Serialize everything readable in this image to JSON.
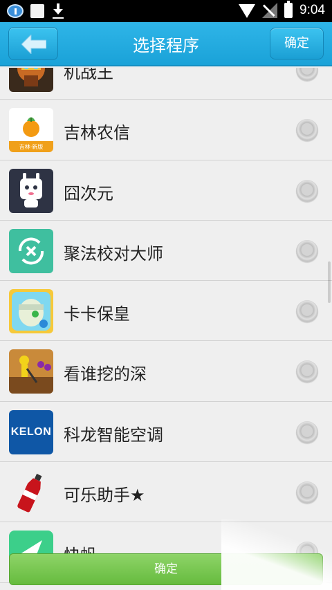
{
  "status_bar": {
    "time": "9:04",
    "icons": [
      "message-icon",
      "square-icon",
      "download-icon",
      "wifi-icon",
      "signal-icon",
      "battery-icon"
    ]
  },
  "header": {
    "title": "选择程序",
    "confirm_label": "确定",
    "back_icon": "back-arrow-icon",
    "color": "#1fa8dd"
  },
  "apps": [
    {
      "name": "机战王",
      "icon": "robot-app-icon"
    },
    {
      "name": "吉林农信",
      "icon": "jilin-nongxin-icon",
      "icon_label": "吉林·新版"
    },
    {
      "name": "囧次元",
      "icon": "jiong-ciyuan-icon"
    },
    {
      "name": "聚法校对大师",
      "icon": "jufa-proofread-icon"
    },
    {
      "name": "卡卡保皇",
      "icon": "kaka-baohuang-icon"
    },
    {
      "name": "看谁挖的深",
      "icon": "dig-game-icon"
    },
    {
      "name": "科龙智能空调",
      "icon": "kelon-icon",
      "icon_text": "KELON"
    },
    {
      "name": "可乐助手★",
      "icon": "cola-bottle-icon"
    },
    {
      "name": "快帆",
      "icon": "kuaifan-icon"
    }
  ],
  "footer": {
    "confirm_label": "确定",
    "color": "#72c24a"
  }
}
